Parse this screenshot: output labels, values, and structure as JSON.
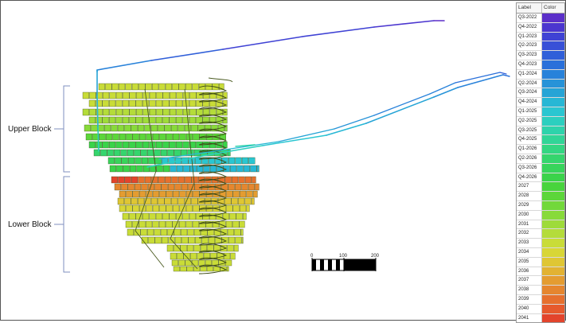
{
  "labels": {
    "upper_block": "Upper Block",
    "lower_block": "Lower Block"
  },
  "scale_bar": {
    "ticks": [
      "0",
      "100",
      "200"
    ]
  },
  "legend": {
    "header_label": "Label",
    "header_color": "Color",
    "items": [
      {
        "label": "Q3-2022",
        "color": "#5b2fc9"
      },
      {
        "label": "Q4-2022",
        "color": "#4b36cf"
      },
      {
        "label": "Q1-2023",
        "color": "#3f42d4"
      },
      {
        "label": "Q2-2023",
        "color": "#3850d7"
      },
      {
        "label": "Q3-2023",
        "color": "#305fd9"
      },
      {
        "label": "Q4-2023",
        "color": "#2a70da"
      },
      {
        "label": "Q1-2024",
        "color": "#2882da"
      },
      {
        "label": "Q2-2024",
        "color": "#2793d8"
      },
      {
        "label": "Q3-2024",
        "color": "#26a4d6"
      },
      {
        "label": "Q4-2024",
        "color": "#27b7d5"
      },
      {
        "label": "Q1-2025",
        "color": "#2ac6d1"
      },
      {
        "label": "Q2-2025",
        "color": "#2ccfbf"
      },
      {
        "label": "Q3-2025",
        "color": "#2ed3ab"
      },
      {
        "label": "Q4-2025",
        "color": "#31d597"
      },
      {
        "label": "Q1-2026",
        "color": "#33d682"
      },
      {
        "label": "Q2-2026",
        "color": "#35d56d"
      },
      {
        "label": "Q3-2026",
        "color": "#37d45b"
      },
      {
        "label": "Q4-2026",
        "color": "#3ad34a"
      },
      {
        "label": "2027",
        "color": "#48d43d"
      },
      {
        "label": "2028",
        "color": "#5cd63a"
      },
      {
        "label": "2029",
        "color": "#72d83a"
      },
      {
        "label": "2030",
        "color": "#88da3a"
      },
      {
        "label": "2031",
        "color": "#9edb3a"
      },
      {
        "label": "2032",
        "color": "#b4dc3a"
      },
      {
        "label": "2033",
        "color": "#c9dc38"
      },
      {
        "label": "2034",
        "color": "#d8d636"
      },
      {
        "label": "2035",
        "color": "#dfc634"
      },
      {
        "label": "2036",
        "color": "#e2b232"
      },
      {
        "label": "2037",
        "color": "#e49c31"
      },
      {
        "label": "2038",
        "color": "#e5862f"
      },
      {
        "label": "2039",
        "color": "#e6702e"
      },
      {
        "label": "2040",
        "color": "#e65a2d"
      },
      {
        "label": "2041",
        "color": "#e3442c"
      }
    ]
  }
}
